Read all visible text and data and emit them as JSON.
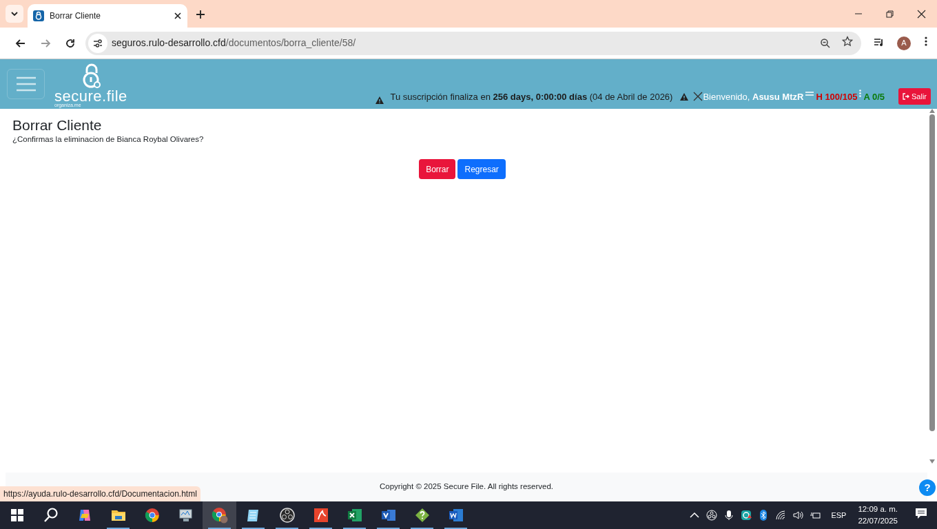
{
  "browser": {
    "tab_title": "Borrar Cliente",
    "url_host": "seguros.rulo-desarrollo.cfd",
    "url_path": "/documentos/borra_cliente/58/",
    "profile_initial": "A",
    "status_url": "https://ayuda.rulo-desarrollo.cfd/Documentacion.html"
  },
  "navbar": {
    "logo_text": "secure.file",
    "logo_tagline": "organiza.me",
    "subscription": "Tu suscripción finaliza en **256 days, 0:00:00 días** (04 de Abril de 2026)",
    "welcome": "Bienvenido, **Asusu MtzR**",
    "h_counter": "H 100/105",
    "a_counter": "A 0/5",
    "logout": "Salir"
  },
  "page": {
    "title": "Borrar Cliente",
    "question": "¿Confirmas la eliminacion de Bianca Roybal Olivares?",
    "buttons": [
      {
        "label": "Borrar",
        "kind": "danger"
      },
      {
        "label": "Regresar",
        "kind": "primary"
      }
    ]
  },
  "footer": {
    "copyright": "Copyright © 2025 Secure File. All rights reserved.",
    "help": "?"
  },
  "taskbar": {
    "apps": [
      {
        "kind": "start",
        "open": false,
        "selected": false
      },
      {
        "kind": "search",
        "open": false,
        "selected": false
      },
      {
        "kind": "copilot",
        "open": false,
        "selected": false
      },
      {
        "kind": "folder",
        "open": true,
        "selected": false
      },
      {
        "kind": "chrome",
        "open": false,
        "selected": false
      },
      {
        "kind": "monitor",
        "open": false,
        "selected": false
      },
      {
        "kind": "chrome-profile",
        "open": true,
        "selected": true
      },
      {
        "kind": "notepad",
        "open": true,
        "selected": false
      },
      {
        "kind": "obs",
        "open": true,
        "selected": false
      },
      {
        "kind": "pdf",
        "open": true,
        "selected": false
      },
      {
        "kind": "excel",
        "open": true,
        "selected": false
      },
      {
        "kind": "visio",
        "open": true,
        "selected": false
      },
      {
        "kind": "help",
        "open": true,
        "selected": false
      },
      {
        "kind": "word",
        "open": true,
        "selected": false
      }
    ],
    "language": "ESP",
    "time": "12:09 a. m.",
    "date": "22/07/2025"
  }
}
